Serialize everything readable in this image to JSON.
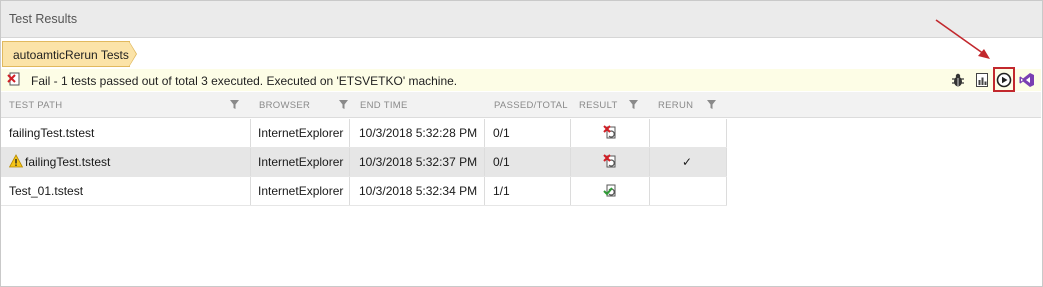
{
  "panel": {
    "title": "Test Results"
  },
  "breadcrumb": {
    "label": "autoamticRerun Tests"
  },
  "status": {
    "message": "Fail - 1 tests passed out of total 3 executed. Executed on 'ETSVETKO' machine.",
    "fail_color": "#d11f26",
    "pass_color": "#2f9a36"
  },
  "toolbar": {
    "icons": [
      "bug-icon",
      "report-icon",
      "run-icon",
      "visual-studio-icon"
    ],
    "highlight_color": "#c2282d"
  },
  "table": {
    "columns": {
      "test_path": "TEST PATH",
      "browser": "BROWSER",
      "end_time": "END TIME",
      "passed_total": "PASSED/TOTAL",
      "result": "RESULT",
      "rerun": "RERUN"
    },
    "rows": [
      {
        "test_path": "failingTest.tstest",
        "browser": "InternetExplorer",
        "end_time": "10/3/2018 5:32:28 PM",
        "passed_total": "0/1",
        "result": "fail",
        "rerun": "",
        "warning": false
      },
      {
        "test_path": "failingTest.tstest",
        "browser": "InternetExplorer",
        "end_time": "10/3/2018 5:32:37 PM",
        "passed_total": "0/1",
        "result": "fail",
        "rerun": "✓",
        "warning": true
      },
      {
        "test_path": "Test_01.tstest",
        "browser": "InternetExplorer",
        "end_time": "10/3/2018 5:32:34 PM",
        "passed_total": "1/1",
        "result": "pass",
        "rerun": "",
        "warning": false
      }
    ]
  }
}
